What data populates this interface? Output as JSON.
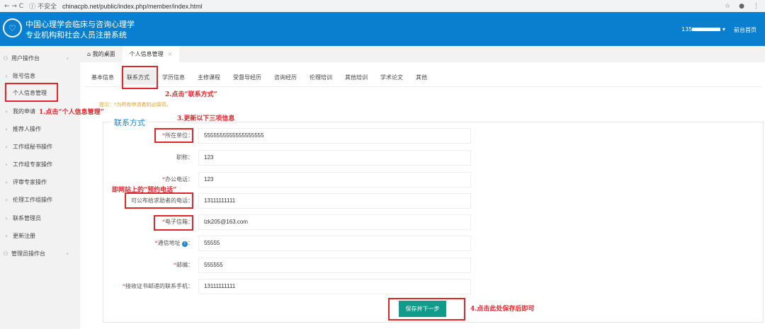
{
  "browser": {
    "nav": "← → C",
    "security": "ⓘ 不安全",
    "url": "chinacpb.net/public/index.php/member/index.html",
    "icons": [
      "star-icon",
      "account-icon",
      "menu-icon"
    ]
  },
  "header": {
    "title_line1": "中国心理学会临床与咨询心理学",
    "title_line2": "专业机构和社会人员注册系统",
    "user": "135",
    "home": "前台首页",
    "color": "#0a7fcf"
  },
  "sidebar": {
    "group1": "用户操作台",
    "items": [
      "账号信息",
      "个人信息管理",
      "我的申请",
      "推荐人操作",
      "工作组秘书操作",
      "工作组专家操作",
      "评审专家操作",
      "伦理工作组操作",
      "联系管理员",
      "更新注册"
    ],
    "group2": "管理员操作台"
  },
  "tabs": {
    "desk": "我的桌面",
    "active": "个人信息管理"
  },
  "subtabs": [
    "基本信息",
    "联系方式",
    "学历信息",
    "主修课程",
    "受督导经历",
    "咨询经历",
    "伦理培训",
    "其他培训",
    "学术论文",
    "其他"
  ],
  "hint": "提示：*为所有申请者的必填项。",
  "section": "联系方式",
  "fields": [
    {
      "req": "*",
      "label": "所在单位：",
      "value": "5555555555555555555"
    },
    {
      "req": "",
      "label": "职称：",
      "value": "123"
    },
    {
      "req": "*",
      "label": "办公电话：",
      "value": "123"
    },
    {
      "req": "",
      "label": "可公布给求助者的电话：",
      "value": "13111111111"
    },
    {
      "req": "*",
      "label": "电子信箱：",
      "value": "lzk205@163.com"
    },
    {
      "req": "*",
      "label": "通信地址",
      "value": "55555"
    },
    {
      "req": "*",
      "label": "邮编：",
      "value": "555555"
    },
    {
      "req": "*",
      "label": "接收证书邮递的联系手机：",
      "value": "13111111111"
    }
  ],
  "save_button": "保存并下一步",
  "annotations": {
    "a1": "1.点击“个人信息管理”",
    "a2": "2.点击“联系方式”",
    "a3": "3.更新以下三项信息",
    "a_phone": "即网站上的“预约电话”",
    "a4": "4.点击此处保存后即可",
    "color": "#e0262b"
  }
}
